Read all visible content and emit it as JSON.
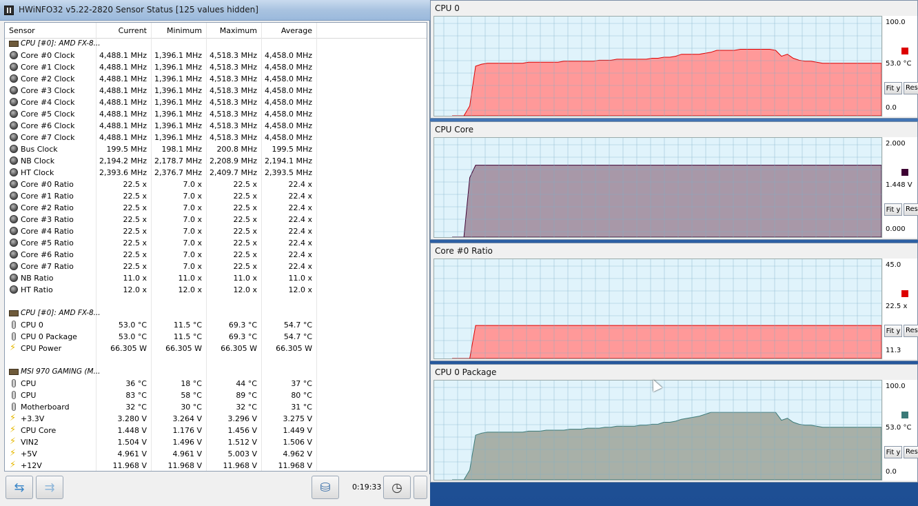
{
  "window": {
    "title": "HWiNFO32 v5.22-2820 Sensor Status [125 values hidden]"
  },
  "columns": [
    "Sensor",
    "Current",
    "Minimum",
    "Maximum",
    "Average"
  ],
  "rows": [
    {
      "kind": "group",
      "icon": "chip-icon",
      "name": "CPU [#0]: AMD FX-8..."
    },
    {
      "kind": "item",
      "icon": "clock-icon",
      "name": "Core #0 Clock",
      "cur": "4,488.1 MHz",
      "min": "1,396.1 MHz",
      "max": "4,518.3 MHz",
      "avg": "4,458.0 MHz"
    },
    {
      "kind": "item",
      "icon": "clock-icon",
      "name": "Core #1 Clock",
      "cur": "4,488.1 MHz",
      "min": "1,396.1 MHz",
      "max": "4,518.3 MHz",
      "avg": "4,458.0 MHz"
    },
    {
      "kind": "item",
      "icon": "clock-icon",
      "name": "Core #2 Clock",
      "cur": "4,488.1 MHz",
      "min": "1,396.1 MHz",
      "max": "4,518.3 MHz",
      "avg": "4,458.0 MHz"
    },
    {
      "kind": "item",
      "icon": "clock-icon",
      "name": "Core #3 Clock",
      "cur": "4,488.1 MHz",
      "min": "1,396.1 MHz",
      "max": "4,518.3 MHz",
      "avg": "4,458.0 MHz"
    },
    {
      "kind": "item",
      "icon": "clock-icon",
      "name": "Core #4 Clock",
      "cur": "4,488.1 MHz",
      "min": "1,396.1 MHz",
      "max": "4,518.3 MHz",
      "avg": "4,458.0 MHz"
    },
    {
      "kind": "item",
      "icon": "clock-icon",
      "name": "Core #5 Clock",
      "cur": "4,488.1 MHz",
      "min": "1,396.1 MHz",
      "max": "4,518.3 MHz",
      "avg": "4,458.0 MHz"
    },
    {
      "kind": "item",
      "icon": "clock-icon",
      "name": "Core #6 Clock",
      "cur": "4,488.1 MHz",
      "min": "1,396.1 MHz",
      "max": "4,518.3 MHz",
      "avg": "4,458.0 MHz"
    },
    {
      "kind": "item",
      "icon": "clock-icon",
      "name": "Core #7 Clock",
      "cur": "4,488.1 MHz",
      "min": "1,396.1 MHz",
      "max": "4,518.3 MHz",
      "avg": "4,458.0 MHz"
    },
    {
      "kind": "item",
      "icon": "clock-icon",
      "name": "Bus Clock",
      "cur": "199.5 MHz",
      "min": "198.1 MHz",
      "max": "200.8 MHz",
      "avg": "199.5 MHz"
    },
    {
      "kind": "item",
      "icon": "clock-icon",
      "name": "NB Clock",
      "cur": "2,194.2 MHz",
      "min": "2,178.7 MHz",
      "max": "2,208.9 MHz",
      "avg": "2,194.1 MHz"
    },
    {
      "kind": "item",
      "icon": "clock-icon",
      "name": "HT Clock",
      "cur": "2,393.6 MHz",
      "min": "2,376.7 MHz",
      "max": "2,409.7 MHz",
      "avg": "2,393.5 MHz"
    },
    {
      "kind": "item",
      "icon": "clock-icon",
      "name": "Core #0 Ratio",
      "cur": "22.5 x",
      "min": "7.0 x",
      "max": "22.5 x",
      "avg": "22.4 x"
    },
    {
      "kind": "item",
      "icon": "clock-icon",
      "name": "Core #1 Ratio",
      "cur": "22.5 x",
      "min": "7.0 x",
      "max": "22.5 x",
      "avg": "22.4 x"
    },
    {
      "kind": "item",
      "icon": "clock-icon",
      "name": "Core #2 Ratio",
      "cur": "22.5 x",
      "min": "7.0 x",
      "max": "22.5 x",
      "avg": "22.4 x"
    },
    {
      "kind": "item",
      "icon": "clock-icon",
      "name": "Core #3 Ratio",
      "cur": "22.5 x",
      "min": "7.0 x",
      "max": "22.5 x",
      "avg": "22.4 x"
    },
    {
      "kind": "item",
      "icon": "clock-icon",
      "name": "Core #4 Ratio",
      "cur": "22.5 x",
      "min": "7.0 x",
      "max": "22.5 x",
      "avg": "22.4 x"
    },
    {
      "kind": "item",
      "icon": "clock-icon",
      "name": "Core #5 Ratio",
      "cur": "22.5 x",
      "min": "7.0 x",
      "max": "22.5 x",
      "avg": "22.4 x"
    },
    {
      "kind": "item",
      "icon": "clock-icon",
      "name": "Core #6 Ratio",
      "cur": "22.5 x",
      "min": "7.0 x",
      "max": "22.5 x",
      "avg": "22.4 x"
    },
    {
      "kind": "item",
      "icon": "clock-icon",
      "name": "Core #7 Ratio",
      "cur": "22.5 x",
      "min": "7.0 x",
      "max": "22.5 x",
      "avg": "22.4 x"
    },
    {
      "kind": "item",
      "icon": "clock-icon",
      "name": "NB Ratio",
      "cur": "11.0 x",
      "min": "11.0 x",
      "max": "11.0 x",
      "avg": "11.0 x"
    },
    {
      "kind": "item",
      "icon": "clock-icon",
      "name": "HT Ratio",
      "cur": "12.0 x",
      "min": "12.0 x",
      "max": "12.0 x",
      "avg": "12.0 x"
    },
    {
      "kind": "blank"
    },
    {
      "kind": "group",
      "icon": "chip-icon",
      "name": "CPU [#0]: AMD FX-8..."
    },
    {
      "kind": "item",
      "icon": "thermometer-icon",
      "name": "CPU 0",
      "cur": "53.0 °C",
      "min": "11.5 °C",
      "max": "69.3 °C",
      "avg": "54.7 °C"
    },
    {
      "kind": "item",
      "icon": "thermometer-icon",
      "name": "CPU 0 Package",
      "cur": "53.0 °C",
      "min": "11.5 °C",
      "max": "69.3 °C",
      "avg": "54.7 °C"
    },
    {
      "kind": "item",
      "icon": "lightning-icon",
      "name": "CPU Power",
      "cur": "66.305 W",
      "min": "66.305 W",
      "max": "66.305 W",
      "avg": "66.305 W"
    },
    {
      "kind": "blank"
    },
    {
      "kind": "group",
      "icon": "chip-icon",
      "name": "MSI 970 GAMING (M..."
    },
    {
      "kind": "item",
      "icon": "thermometer-icon",
      "name": "CPU",
      "cur": "36 °C",
      "min": "18 °C",
      "max": "44 °C",
      "avg": "37 °C"
    },
    {
      "kind": "item",
      "icon": "thermometer-icon",
      "name": "CPU",
      "cur": "83 °C",
      "min": "58 °C",
      "max": "89 °C",
      "avg": "80 °C"
    },
    {
      "kind": "item",
      "icon": "thermometer-icon",
      "name": "Motherboard",
      "cur": "32 °C",
      "min": "30 °C",
      "max": "32 °C",
      "avg": "31 °C"
    },
    {
      "kind": "item",
      "icon": "lightning-icon",
      "name": "+3.3V",
      "cur": "3.280 V",
      "min": "3.264 V",
      "max": "3.296 V",
      "avg": "3.275 V"
    },
    {
      "kind": "item",
      "icon": "lightning-icon",
      "name": "CPU Core",
      "cur": "1.448 V",
      "min": "1.176 V",
      "max": "1.456 V",
      "avg": "1.449 V"
    },
    {
      "kind": "item",
      "icon": "lightning-icon",
      "name": "VIN2",
      "cur": "1.504 V",
      "min": "1.496 V",
      "max": "1.512 V",
      "avg": "1.506 V"
    },
    {
      "kind": "item",
      "icon": "lightning-icon",
      "name": "+5V",
      "cur": "4.961 V",
      "min": "4.961 V",
      "max": "5.003 V",
      "avg": "4.962 V"
    },
    {
      "kind": "item",
      "icon": "lightning-icon",
      "name": "+12V",
      "cur": "11.968 V",
      "min": "11.968 V",
      "max": "11.968 V",
      "avg": "11.968 V"
    }
  ],
  "statusbar": {
    "timer": "0:19:33"
  },
  "graphs": [
    {
      "title": "CPU 0",
      "top_label": "100.0",
      "current_label": "53.0 °C",
      "bottom_label": "0.0",
      "color": "#ff9999",
      "swatch": "#dd0000",
      "fit_label": "Fit y",
      "reset_label": "Reset",
      "ymin": 0,
      "ymax": 100,
      "values": [
        0,
        0,
        0,
        10,
        50,
        52,
        53,
        53,
        53,
        53,
        53,
        53,
        53,
        54,
        54,
        54,
        54,
        54,
        54,
        55,
        55,
        55,
        55,
        55,
        55,
        56,
        56,
        56,
        57,
        57,
        57,
        57,
        57,
        57,
        58,
        58,
        59,
        59,
        60,
        62,
        62,
        62,
        62,
        63,
        64,
        66,
        66,
        66,
        66,
        67,
        67,
        67,
        67,
        67,
        67,
        66,
        60,
        62,
        58,
        56,
        55,
        55,
        54,
        53,
        53,
        53,
        53,
        53,
        53,
        53,
        53,
        53,
        53,
        53
      ]
    },
    {
      "title": "CPU Core",
      "top_label": "2.000",
      "current_label": "1.448 V",
      "bottom_label": "0.000",
      "color": "#a898a8",
      "swatch": "#3d0033",
      "fit_label": "Fit y",
      "reset_label": "Reset",
      "ymin": 0,
      "ymax": 2,
      "values": [
        0,
        0,
        0,
        1.2,
        1.45,
        1.45,
        1.45,
        1.45,
        1.45,
        1.45,
        1.45,
        1.45,
        1.45,
        1.45,
        1.45,
        1.45,
        1.45,
        1.45,
        1.45,
        1.45,
        1.45,
        1.45,
        1.45,
        1.45,
        1.45,
        1.45,
        1.45,
        1.45,
        1.45,
        1.45,
        1.45,
        1.45,
        1.45,
        1.45,
        1.45,
        1.45,
        1.45,
        1.45,
        1.45,
        1.45,
        1.45,
        1.45,
        1.45,
        1.45,
        1.45,
        1.45,
        1.45,
        1.45,
        1.45,
        1.45,
        1.45,
        1.45,
        1.45,
        1.45,
        1.45,
        1.45,
        1.45,
        1.45,
        1.45,
        1.45,
        1.45,
        1.45,
        1.45,
        1.45,
        1.45,
        1.45,
        1.45,
        1.45,
        1.45,
        1.45,
        1.45,
        1.45,
        1.45,
        1.45
      ]
    },
    {
      "title": "Core #0 Ratio",
      "top_label": "45.0",
      "current_label": "22.5 x",
      "bottom_label": "11.3",
      "color": "#ff9999",
      "swatch": "#dd0000",
      "fit_label": "Fit y",
      "reset_label": "Reset",
      "ymin": 11.3,
      "ymax": 45,
      "values": [
        11.3,
        11.3,
        11.3,
        11.3,
        22.5,
        22.5,
        22.5,
        22.5,
        22.5,
        22.5,
        22.5,
        22.5,
        22.5,
        22.5,
        22.5,
        22.5,
        22.5,
        22.5,
        22.5,
        22.5,
        22.5,
        22.5,
        22.5,
        22.5,
        22.5,
        22.5,
        22.5,
        22.5,
        22.5,
        22.5,
        22.5,
        22.5,
        22.5,
        22.5,
        22.5,
        22.5,
        22.5,
        22.5,
        22.5,
        22.5,
        22.5,
        22.5,
        22.5,
        22.5,
        22.5,
        22.5,
        22.5,
        22.5,
        22.5,
        22.5,
        22.5,
        22.5,
        22.5,
        22.5,
        22.5,
        22.5,
        22.5,
        22.5,
        22.5,
        22.5,
        22.5,
        22.5,
        22.5,
        22.5,
        22.5,
        22.5,
        22.5,
        22.5,
        22.5,
        22.5,
        22.5,
        22.5,
        22.5,
        22.5
      ]
    },
    {
      "title": "CPU 0 Package",
      "top_label": "100.0",
      "current_label": "53.0 °C",
      "bottom_label": "0.0",
      "color": "#a8b0a8",
      "swatch": "#3a7a78",
      "fit_label": "Fit y",
      "reset_label": "Reset",
      "ymin": 0,
      "ymax": 100,
      "values": [
        0,
        0,
        0,
        10,
        45,
        47,
        48,
        48,
        48,
        48,
        48,
        48,
        48,
        49,
        49,
        49,
        50,
        50,
        50,
        50,
        51,
        51,
        51,
        52,
        52,
        52,
        53,
        53,
        54,
        54,
        54,
        54,
        55,
        55,
        56,
        56,
        58,
        58,
        59,
        61,
        62,
        63,
        64,
        66,
        68,
        68,
        68,
        68,
        68,
        68,
        68,
        68,
        68,
        68,
        68,
        68,
        60,
        62,
        58,
        56,
        55,
        55,
        54,
        53,
        53,
        53,
        53,
        53,
        53,
        53,
        53,
        53,
        53,
        53
      ]
    }
  ]
}
